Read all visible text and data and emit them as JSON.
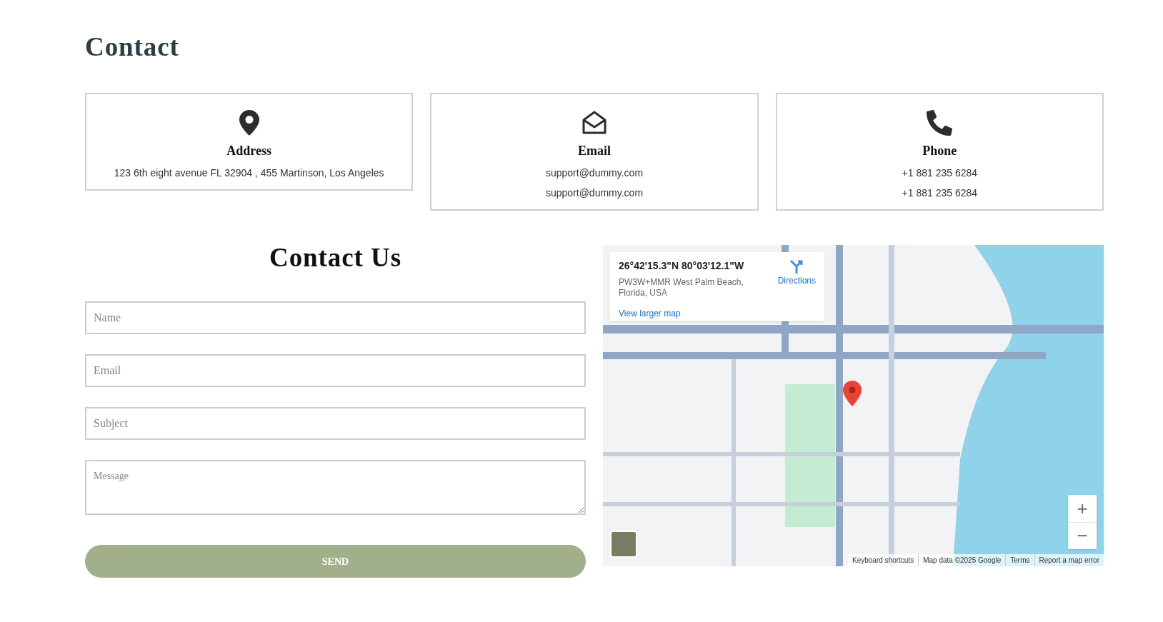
{
  "heading": "Contact",
  "cards": [
    {
      "kind": "pin",
      "title": "Address",
      "lines": [
        "123 6th eight avenue FL 32904 , 455 Martinson, Los Angeles"
      ]
    },
    {
      "kind": "envelope",
      "title": "Email",
      "lines": [
        "support@dummy.com",
        "support@dummy.com"
      ]
    },
    {
      "kind": "phone",
      "title": "Phone",
      "lines": [
        "+1 881 235 6284",
        "+1 881 235 6284"
      ]
    }
  ],
  "form": {
    "title": "Contact Us",
    "fields": [
      {
        "kind": "input",
        "placeholder": "Name"
      },
      {
        "kind": "input",
        "placeholder": "Email"
      },
      {
        "kind": "input",
        "placeholder": "Subject"
      },
      {
        "kind": "textarea",
        "placeholder": "Message"
      }
    ],
    "button": "SEND"
  },
  "map": {
    "info": {
      "coordinates": "26°42'15.3\"N 80°03'12.1\"W",
      "address": "PW3W+MMR West Palm Beach, Florida, USA",
      "directions": "Directions",
      "larger_map": "View larger map"
    },
    "zoom": [
      "+",
      "−"
    ],
    "attribution": [
      "Keyboard shortcuts",
      "Map data ©2025 Google",
      "Terms",
      "Report a map error"
    ]
  }
}
